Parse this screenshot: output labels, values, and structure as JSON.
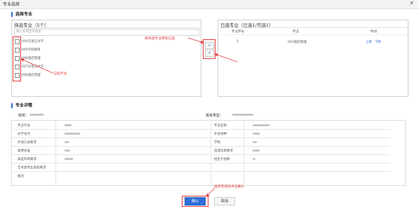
{
  "window": {
    "title": "专业选择",
    "close_glyph": "✕"
  },
  "select_section": {
    "title": "选择专业"
  },
  "left_panel": {
    "title": "待选专业（5个）",
    "search_placeholder": "输入名称回车搜索",
    "items": [
      {
        "label": "004汉语言文学"
      },
      {
        "label": "005学前教育"
      },
      {
        "label": "006酒店管理"
      },
      {
        "label": "007汉语言文学"
      },
      {
        "label": "008酒店管理"
      }
    ]
  },
  "move_buttons": {
    "to_right": "»",
    "to_left": "«"
  },
  "right_panel": {
    "title": "已选专业（已选1/可选1）",
    "headers": [
      "专业序号",
      "专业",
      "移动"
    ],
    "rows": [
      {
        "index": "1",
        "name": "003酒店管理",
        "up": "上移",
        "down": "下移"
      }
    ]
  },
  "annotations": {
    "move_right": "将待选专业移到已选",
    "check": "勾选专业",
    "move_back": "将已选专业移回待选",
    "confirm": "选择完成后点击确认"
  },
  "detail_section": {
    "title": "专业详情",
    "school_label": "院校：",
    "exam_type_label": "报考类型：",
    "rows": [
      {
        "left_label": "专业代号",
        "right_label": "专业名称"
      },
      {
        "left_label": "办学地点",
        "right_label": "外语语种"
      },
      {
        "left_label": "外语口试要求",
        "right_label": "学制"
      },
      {
        "left_label": "收费标准",
        "right_label": "首选科目要求"
      },
      {
        "left_label": "再选科目要求",
        "right_label": "招生计划数"
      },
      {
        "left_label": "艺术类专业类别要求",
        "right_label": ""
      },
      {
        "left_label": "备注",
        "right_label": ""
      }
    ]
  },
  "footer": {
    "confirm": "确认",
    "cancel": "取消"
  },
  "colors": {
    "accent": "#2f6fd8",
    "annotation": "#e23a3a"
  }
}
